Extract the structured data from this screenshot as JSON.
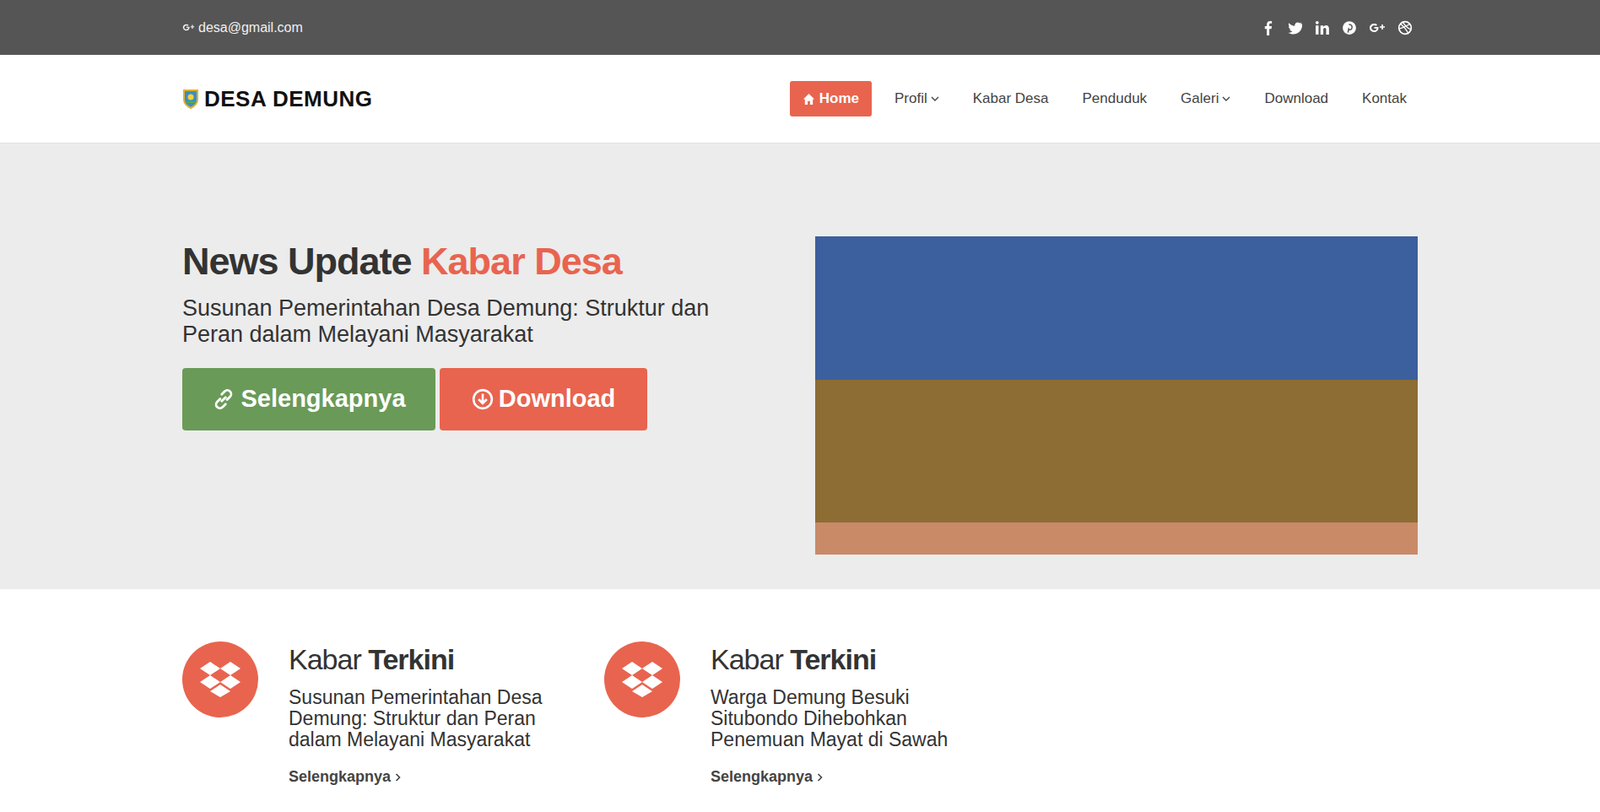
{
  "topbar": {
    "email": "desa@gmail.com"
  },
  "logo": {
    "text": "DESA DEMUNG"
  },
  "nav": [
    {
      "label": "Home",
      "selected": true,
      "dropdown": false
    },
    {
      "label": "Profil",
      "selected": false,
      "dropdown": true
    },
    {
      "label": "Kabar Desa",
      "selected": false,
      "dropdown": false
    },
    {
      "label": "Penduduk",
      "selected": false,
      "dropdown": false
    },
    {
      "label": "Galeri",
      "selected": false,
      "dropdown": true
    },
    {
      "label": "Download",
      "selected": false,
      "dropdown": false
    },
    {
      "label": "Kontak",
      "selected": false,
      "dropdown": false
    }
  ],
  "hero": {
    "title": "News Update",
    "highlight": "Kabar Desa",
    "subtitle": "Susunan Pemerintahan Desa Demung: Struktur dan Peran dalam Melayani Masyarakat",
    "buttons": [
      {
        "label": "Selengkapnya",
        "kind": "link"
      },
      {
        "label": "Download",
        "kind": "download"
      }
    ]
  },
  "features": [
    {
      "title": "Kabar",
      "title_bold": "Terkini",
      "text": "Susunan Pemerintahan Desa Demung: Struktur dan Peran dalam Melayani Masyarakat",
      "link": "Selengkapnya"
    },
    {
      "title": "Kabar",
      "title_bold": "Terkini",
      "text": "Warga Demung Besuki Situbondo Dihebohkan Penemuan Mayat di Sawah",
      "link": "Selengkapnya"
    }
  ]
}
